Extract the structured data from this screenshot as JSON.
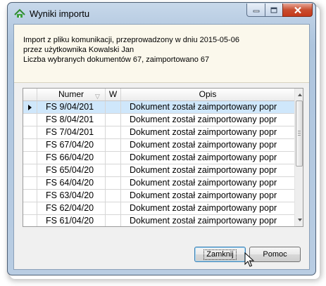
{
  "window": {
    "title": "Wyniki importu"
  },
  "info": {
    "line1": "Import z pliku komunikacji, przeprowadzony w dniu 2015-05-06",
    "line2": "przez użytkownika Kowalski Jan",
    "line3": "Liczba wybranych dokumentów 67, zaimportowano 67"
  },
  "grid": {
    "columns": {
      "numer": "Numer",
      "w": "W",
      "opis": "Opis"
    },
    "rows": [
      {
        "numer": "FS 9/04/201",
        "w": "",
        "opis": "Dokument został zaimportowany popr"
      },
      {
        "numer": "FS 8/04/201",
        "w": "",
        "opis": "Dokument został zaimportowany popr"
      },
      {
        "numer": "FS 7/04/201",
        "w": "",
        "opis": "Dokument został zaimportowany popr"
      },
      {
        "numer": "FS 67/04/20",
        "w": "",
        "opis": "Dokument został zaimportowany popr"
      },
      {
        "numer": "FS 66/04/20",
        "w": "",
        "opis": "Dokument został zaimportowany popr"
      },
      {
        "numer": "FS 65/04/20",
        "w": "",
        "opis": "Dokument został zaimportowany popr"
      },
      {
        "numer": "FS 64/04/20",
        "w": "",
        "opis": "Dokument został zaimportowany popr"
      },
      {
        "numer": "FS 63/04/20",
        "w": "",
        "opis": "Dokument został zaimportowany popr"
      },
      {
        "numer": "FS 62/04/20",
        "w": "",
        "opis": "Dokument został zaimportowany popr"
      },
      {
        "numer": "FS 61/04/20",
        "w": "",
        "opis": "Dokument został zaimportowany popr"
      }
    ]
  },
  "buttons": {
    "zamknij": "Zamknij",
    "pomoc": "Pomoc"
  },
  "colors": {
    "selected_row": "#cfe7fb",
    "info_background": "#fbf8ec",
    "close_button": "#c84e2f"
  },
  "icons": {
    "app": "green-app-icon",
    "minimize": "minimize-icon",
    "maximize": "maximize-icon",
    "close": "close-icon",
    "sort": "sort-indicator-icon",
    "row_indicator": "current-row-arrow-icon",
    "cursor": "mouse-pointer-icon"
  }
}
